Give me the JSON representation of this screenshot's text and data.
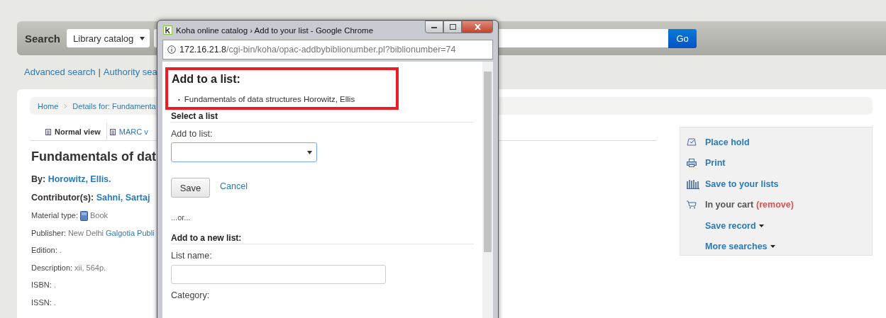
{
  "search_bar": {
    "label": "Search",
    "scope_select": "Library catalog",
    "go_button": "Go"
  },
  "links": [
    {
      "label": "Advanced search"
    },
    {
      "label": "Authority sea"
    }
  ],
  "link_separator": "|",
  "breadcrumbs": [
    "Home",
    "Details for: Fundamenta"
  ],
  "tabs": [
    {
      "label": "Normal view",
      "selected": true
    },
    {
      "label": "MARC v",
      "selected": false
    }
  ],
  "record": {
    "title": "Fundamentals of dat",
    "by_label": "By:",
    "author": "Horowitz, Ellis.",
    "contributors_label": "Contributor(s):",
    "contributor": "Sahni, Sartaj",
    "fields": [
      {
        "label": "Material type:",
        "value": "Book",
        "kind": "material"
      },
      {
        "label": "Publisher:",
        "value": "New Delhi",
        "link": "Galgotia Publi",
        "kind": "text"
      },
      {
        "label": "Edition:",
        "value": ".",
        "kind": "text"
      },
      {
        "label": "Description:",
        "value": "xii, 564p.",
        "kind": "text"
      },
      {
        "label": "ISBN:",
        "value": ".",
        "kind": "text"
      },
      {
        "label": "ISSN:",
        "value": ".",
        "kind": "text"
      }
    ]
  },
  "actions": [
    {
      "label": "Place hold",
      "kind": "hold"
    },
    {
      "label": "Print",
      "kind": "print"
    },
    {
      "label": "Save to your lists",
      "kind": "lists"
    },
    {
      "label": "In your cart",
      "extra": "(remove)",
      "kind": "cart"
    },
    {
      "label": "Save record",
      "kind": "dropdown"
    },
    {
      "label": "More searches",
      "kind": "dropdown"
    }
  ],
  "popup": {
    "window_title": "Koha online catalog › Add to your list - Google Chrome",
    "url_host": "172.16.21.8",
    "url_path": "/cgi-bin/koha/opac-addbybiblionumber.pl?biblionumber=74",
    "heading": "Add to a list:",
    "item_marker": "•",
    "items": [
      "Fundamentals of data structures Horowitz, Ellis"
    ],
    "select_section": "Select a list",
    "add_to_list_label": "Add to list:",
    "save_button": "Save",
    "cancel_link": "Cancel",
    "or_text": "...or...",
    "new_section": "Add to a new list:",
    "list_name_label": "List name:",
    "category_label": "Category:"
  }
}
